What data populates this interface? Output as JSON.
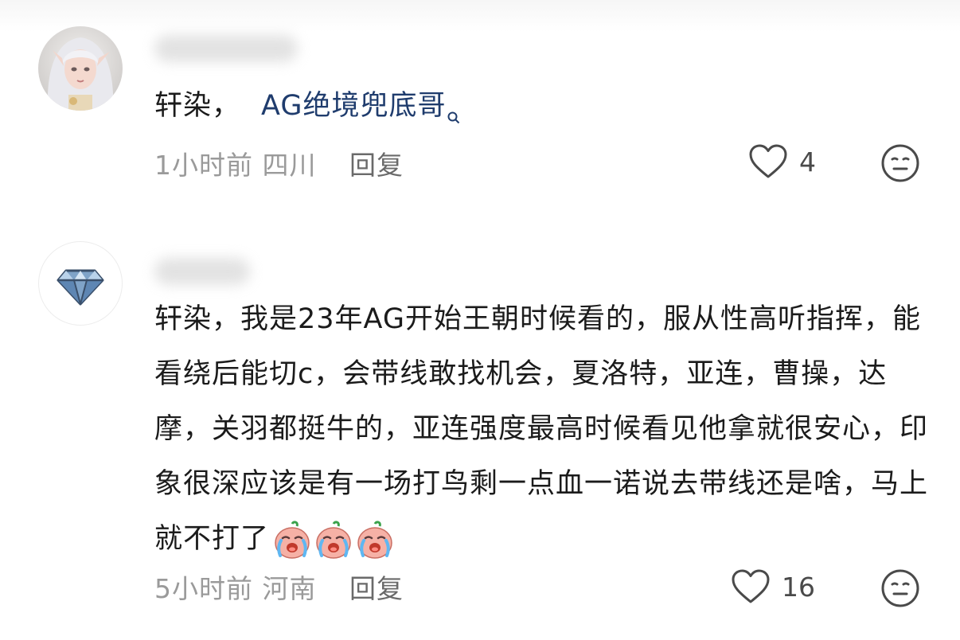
{
  "comments": [
    {
      "text_prefix": "轩染，",
      "mention": "AG绝境兜底哥",
      "meta_time": "1小时前",
      "meta_location": "四川",
      "reply_label": "回复",
      "like_count": "4",
      "avatar_icon": "anime-cosplay-avatar",
      "like_icon": "heart-outline-icon",
      "reaction_icon": "neutral-face-icon"
    },
    {
      "text": "轩染，我是23年AG开始王朝时候看的，服从性高听指挥，能看绕后能切c，会带线敢找机会，夏洛特，亚连，曹操，达摩，关羽都挺牛的，亚连强度最高时候看见他拿就很安心，印象很深应该是有一场打鸟剩一点血一诺说去带线还是啥，马上就不打了",
      "emoji_count": 3,
      "meta_time": "5小时前",
      "meta_location": "河南",
      "reply_label": "回复",
      "like_count": "16",
      "avatar_icon": "diamond-icon",
      "emoji_icon": "crying-face-emoji",
      "like_icon": "heart-outline-icon",
      "reaction_icon": "neutral-face-icon"
    }
  ],
  "colors": {
    "mention": "#1f3c6d",
    "meta": "#9a9a9a",
    "text": "#1b1b1b"
  }
}
